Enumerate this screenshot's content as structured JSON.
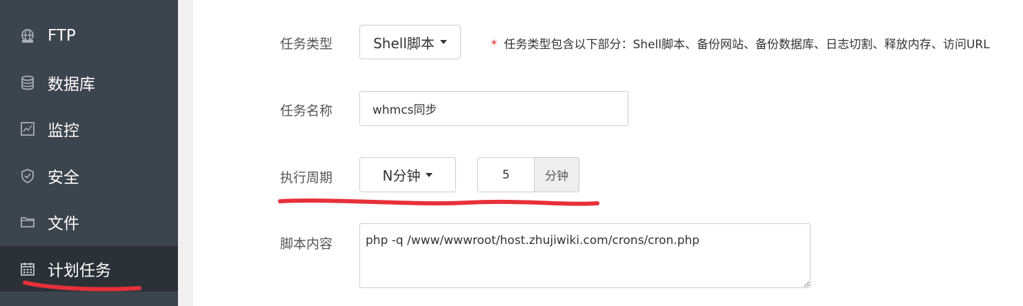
{
  "sidebar": {
    "items": [
      {
        "label": "FTP",
        "icon": "globe-icon"
      },
      {
        "label": "数据库",
        "icon": "database-icon"
      },
      {
        "label": "监控",
        "icon": "monitor-chart-icon"
      },
      {
        "label": "安全",
        "icon": "shield-icon"
      },
      {
        "label": "文件",
        "icon": "folder-icon"
      },
      {
        "label": "计划任务",
        "icon": "calendar-icon",
        "active": true
      }
    ]
  },
  "form": {
    "task_type": {
      "label": "任务类型",
      "value": "Shell脚本",
      "hint_star": "*",
      "hint": "任务类型包含以下部分：Shell脚本、备份网站、备份数据库、日志切割、释放内存、访问URL"
    },
    "task_name": {
      "label": "任务名称",
      "value": "whmcs同步"
    },
    "period": {
      "label": "执行周期",
      "mode": "N分钟",
      "value": "5",
      "unit": "分钟"
    },
    "script": {
      "label": "脚本内容",
      "value": "php -q /www/wwwroot/host.zhujiwiki.com/crons/cron.php"
    }
  },
  "colors": {
    "sidebar_bg": "#3c444d",
    "sidebar_active_bg": "#2c3138",
    "annotation_red": "#e8303a"
  }
}
